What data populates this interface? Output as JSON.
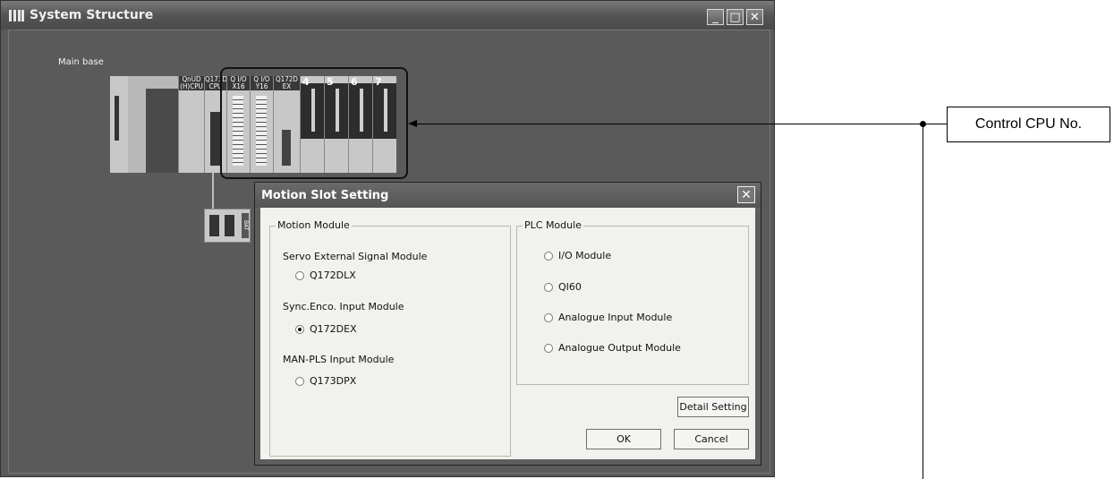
{
  "window": {
    "title": "System Structure",
    "main_base_label": "Main base",
    "controls": {
      "minimize": "_",
      "maximize": "□",
      "close": "✕"
    }
  },
  "rack": {
    "modules": [
      {
        "label": "QnUD\n(H)CPU"
      },
      {
        "label": "Q173D\nCPU"
      },
      {
        "label": "Q I/O\nX16"
      },
      {
        "label": "Q I/O\nY16"
      },
      {
        "label": "Q172D\nEX"
      }
    ],
    "slot_numbers": [
      "4",
      "5",
      "6",
      "7"
    ],
    "battery_label": "BAT"
  },
  "dialog": {
    "title": "Motion Slot Setting",
    "close": "✕",
    "motion_module": {
      "title": "Motion Module",
      "servo_label": "Servo External Signal Module",
      "servo_option": "Q172DLX",
      "sync_label": "Sync.Enco. Input Module",
      "sync_option": "Q172DEX",
      "manpls_label": "MAN-PLS Input Module",
      "manpls_option": "Q173DPX",
      "selected": "Q172DEX"
    },
    "plc_module": {
      "title": "PLC Module",
      "options": [
        "I/O Module",
        "QI60",
        "Analogue Input Module",
        "Analogue Output Module"
      ]
    },
    "buttons": {
      "detail": "Detail Setting",
      "ok": "OK",
      "cancel": "Cancel"
    }
  },
  "callout": {
    "text": "Control CPU No."
  }
}
